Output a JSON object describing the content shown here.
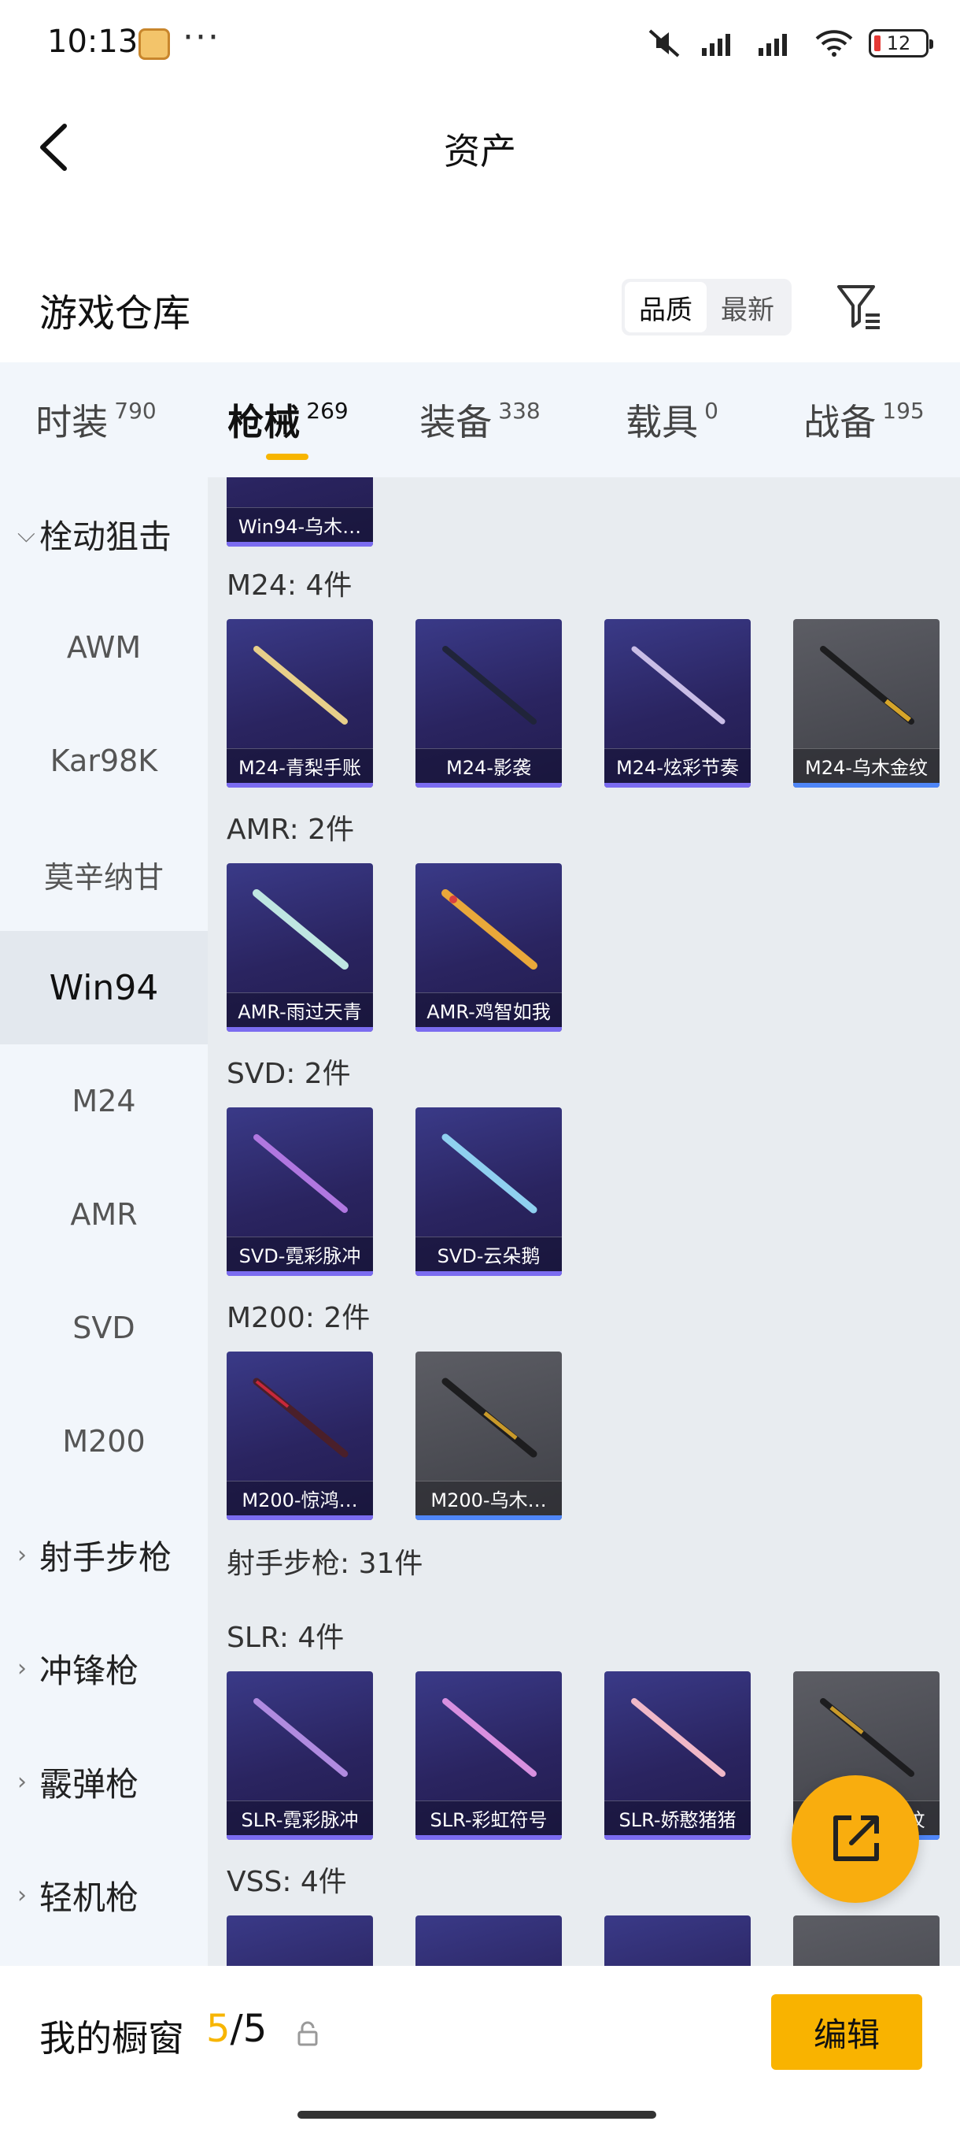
{
  "status_bar": {
    "time": "10:13",
    "dots": "···",
    "battery": "12"
  },
  "header": {
    "title": "资产"
  },
  "warehouse": {
    "title": "游戏仓库",
    "sort_options": [
      "品质",
      "最新"
    ],
    "sort_selected": "品质"
  },
  "tabs": [
    {
      "label": "时装",
      "count": "790"
    },
    {
      "label": "枪械",
      "count": "269",
      "active": true
    },
    {
      "label": "装备",
      "count": "338"
    },
    {
      "label": "载具",
      "count": "0"
    },
    {
      "label": "战备",
      "count": "195"
    }
  ],
  "sidebar": {
    "items": [
      {
        "label": "栓动狙击",
        "group": true,
        "expanded": true
      },
      {
        "label": "AWM"
      },
      {
        "label": "Kar98K"
      },
      {
        "label": "莫辛纳甘"
      },
      {
        "label": "Win94",
        "active": true
      },
      {
        "label": "M24"
      },
      {
        "label": "AMR"
      },
      {
        "label": "SVD"
      },
      {
        "label": "M200"
      },
      {
        "label": "射手步枪",
        "group": true
      },
      {
        "label": "冲锋枪",
        "group": true
      },
      {
        "label": "霰弹枪",
        "group": true
      },
      {
        "label": "轻机枪",
        "group": true
      }
    ]
  },
  "content": {
    "top_item": "Win94-乌木…",
    "sections": [
      {
        "title": "M24: 4件",
        "items": [
          "M24-青梨手账",
          "M24-影袭",
          "M24-炫彩节奏",
          "M24-乌木金纹"
        ]
      },
      {
        "title": "AMR: 2件",
        "items": [
          "AMR-雨过天青",
          "AMR-鸡智如我"
        ]
      },
      {
        "title": "SVD: 2件",
        "items": [
          "SVD-霓彩脉冲",
          "SVD-云朵鹅"
        ]
      },
      {
        "title": "M200: 2件",
        "items": [
          "M200-惊鸿…",
          "M200-乌木…"
        ]
      },
      {
        "title": "射手步枪: 31件",
        "items": []
      },
      {
        "title": "SLR: 4件",
        "items": [
          "SLR-霓彩脉冲",
          "SLR-彩虹符号",
          "SLR-娇憨猪猪",
          "SLR-乌木金纹"
        ]
      },
      {
        "title": "VSS: 4件",
        "items": []
      }
    ]
  },
  "bottom_bar": {
    "label": "我的橱窗",
    "count_current": "5",
    "count_sep": "/",
    "count_total": "5",
    "edit_label": "编辑"
  },
  "colors": {
    "accent": "#f7b500",
    "item_purple": "#2a2460",
    "item_gray": "#4a4b52"
  }
}
